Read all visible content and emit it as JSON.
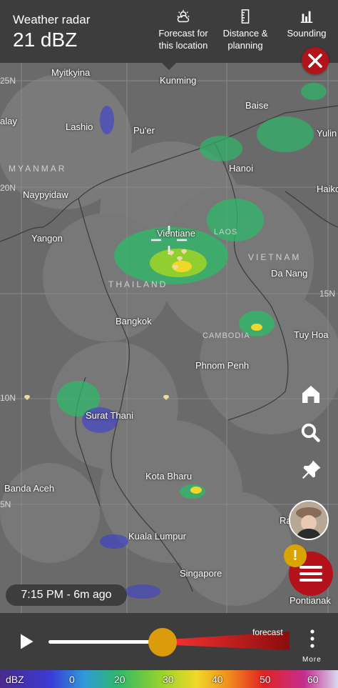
{
  "header": {
    "title": "Weather radar",
    "value": "21 dBZ",
    "buttons": [
      {
        "line1": "Forecast for",
        "line2": "this location",
        "icon": "cloud-sun-icon"
      },
      {
        "line1": "Distance &",
        "line2": "planning",
        "icon": "ruler-icon"
      },
      {
        "line1": "Sounding",
        "line2": "",
        "icon": "bar-chart-icon"
      }
    ]
  },
  "map": {
    "cities": {
      "myitkyina": "Myitkyina",
      "kunming": "Kunming",
      "baise": "Baise",
      "lashio": "Lashio",
      "puer": "Pu'er",
      "yulin": "Yulin",
      "alay": "alay",
      "hanoi": "Hanoi",
      "haikou": "Haiko",
      "naypyidaw": "Naypyidaw",
      "vientiane": "Vientiane",
      "yangon": "Yangon",
      "danang": "Da Nang",
      "bangkok": "Bangkok",
      "tuyhoa": "Tuy Hoa",
      "phnompenh": "Phnom Penh",
      "suratthani": "Surat Thani",
      "kotabharu": "Kota Bharu",
      "bandaaceh": "Banda Aceh",
      "kualalumpur": "Kuala Lumpur",
      "singapore": "Singapore",
      "pontianak": "Pontianak",
      "ra": "Ra"
    },
    "countries": {
      "myanmar": "MYANMAR",
      "laos": "LAOS",
      "vietnam": "VIETNAM",
      "thailand": "THAILAND",
      "cambodia": "CAMBODIA"
    },
    "latitudes": {
      "n25": "25N",
      "n20": "20N",
      "n15": "15N",
      "n10": "10N",
      "n5": "5N"
    },
    "time_label": "7:15 PM - 6m ago"
  },
  "player": {
    "forecast_label": "forecast",
    "more_label": "More",
    "progress": 0.42
  },
  "legend": {
    "unit": "dBZ",
    "ticks": [
      "0",
      "20",
      "30",
      "40",
      "50",
      "60"
    ]
  },
  "colors": {
    "accent_red": "#b3121b",
    "slider_orange": "#dc9b0a",
    "warning_yellow": "#d9a300"
  }
}
